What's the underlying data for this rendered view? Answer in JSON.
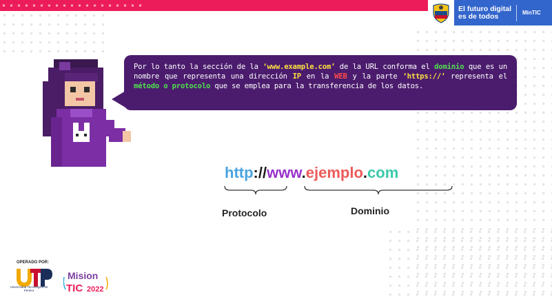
{
  "header": {
    "gov_title": "El futuro digital es de todos",
    "ministry": "MinTIC",
    "colors": {
      "topbar": "#ec1c5b",
      "gov_panel": "#3366cc"
    }
  },
  "bubble": {
    "segments": [
      {
        "text": "Por lo tanto la sección de la ",
        "style": "normal"
      },
      {
        "text": "‘www.example.com’",
        "style": "yellow"
      },
      {
        "text": " de la URL conforma el ",
        "style": "normal"
      },
      {
        "text": "dominio",
        "style": "green"
      },
      {
        "text": " que es un nombre que representa una dirección ",
        "style": "normal"
      },
      {
        "text": "IP",
        "style": "yellow"
      },
      {
        "text": " en la ",
        "style": "normal"
      },
      {
        "text": "WEB",
        "style": "red"
      },
      {
        "text": " y la parte ",
        "style": "normal"
      },
      {
        "text": "‘https://’",
        "style": "yellow"
      },
      {
        "text": " representa el ",
        "style": "normal"
      },
      {
        "text": "método o protocolo",
        "style": "green"
      },
      {
        "text": " que se emplea para la transferencia de los datos.",
        "style": "normal"
      }
    ],
    "colors": {
      "background": "#4b1c6d",
      "yellow": "#fde043",
      "green": "#4ee24e",
      "red": "#ff4a4a"
    }
  },
  "url": {
    "http": "http",
    "separator": "://",
    "www": "www",
    "dot1": ".",
    "domain": "ejemplo",
    "dot2": ".",
    "tld": "com"
  },
  "labels": {
    "protocol": "Protocolo",
    "domain": "Dominio"
  },
  "footer": {
    "operated_by": "OPERADO POR:",
    "utp_name": "Universidad Tecnológica de Pereira",
    "mision": "Mision",
    "tic": "TIC",
    "year": "2022"
  }
}
